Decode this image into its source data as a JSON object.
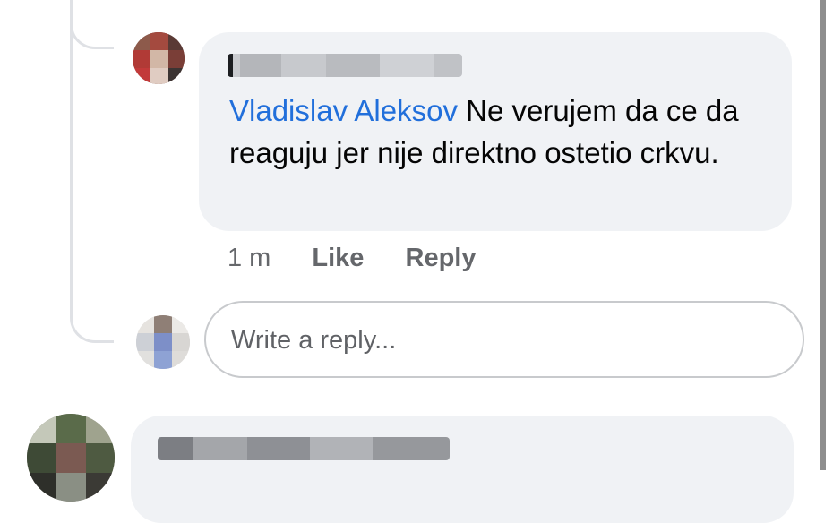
{
  "comment": {
    "mention": "Vladislav Aleksov",
    "text": " Ne verujem da ce da reaguju jer nije direktno ostetio crkvu.",
    "actions": {
      "time": "1 m",
      "like": "Like",
      "reply": "Reply"
    }
  },
  "reply_box": {
    "placeholder": "Write a reply..."
  },
  "colors": {
    "mention": "#216fdb",
    "bubble_bg": "#f0f2f5",
    "secondary_text": "#65676b"
  }
}
